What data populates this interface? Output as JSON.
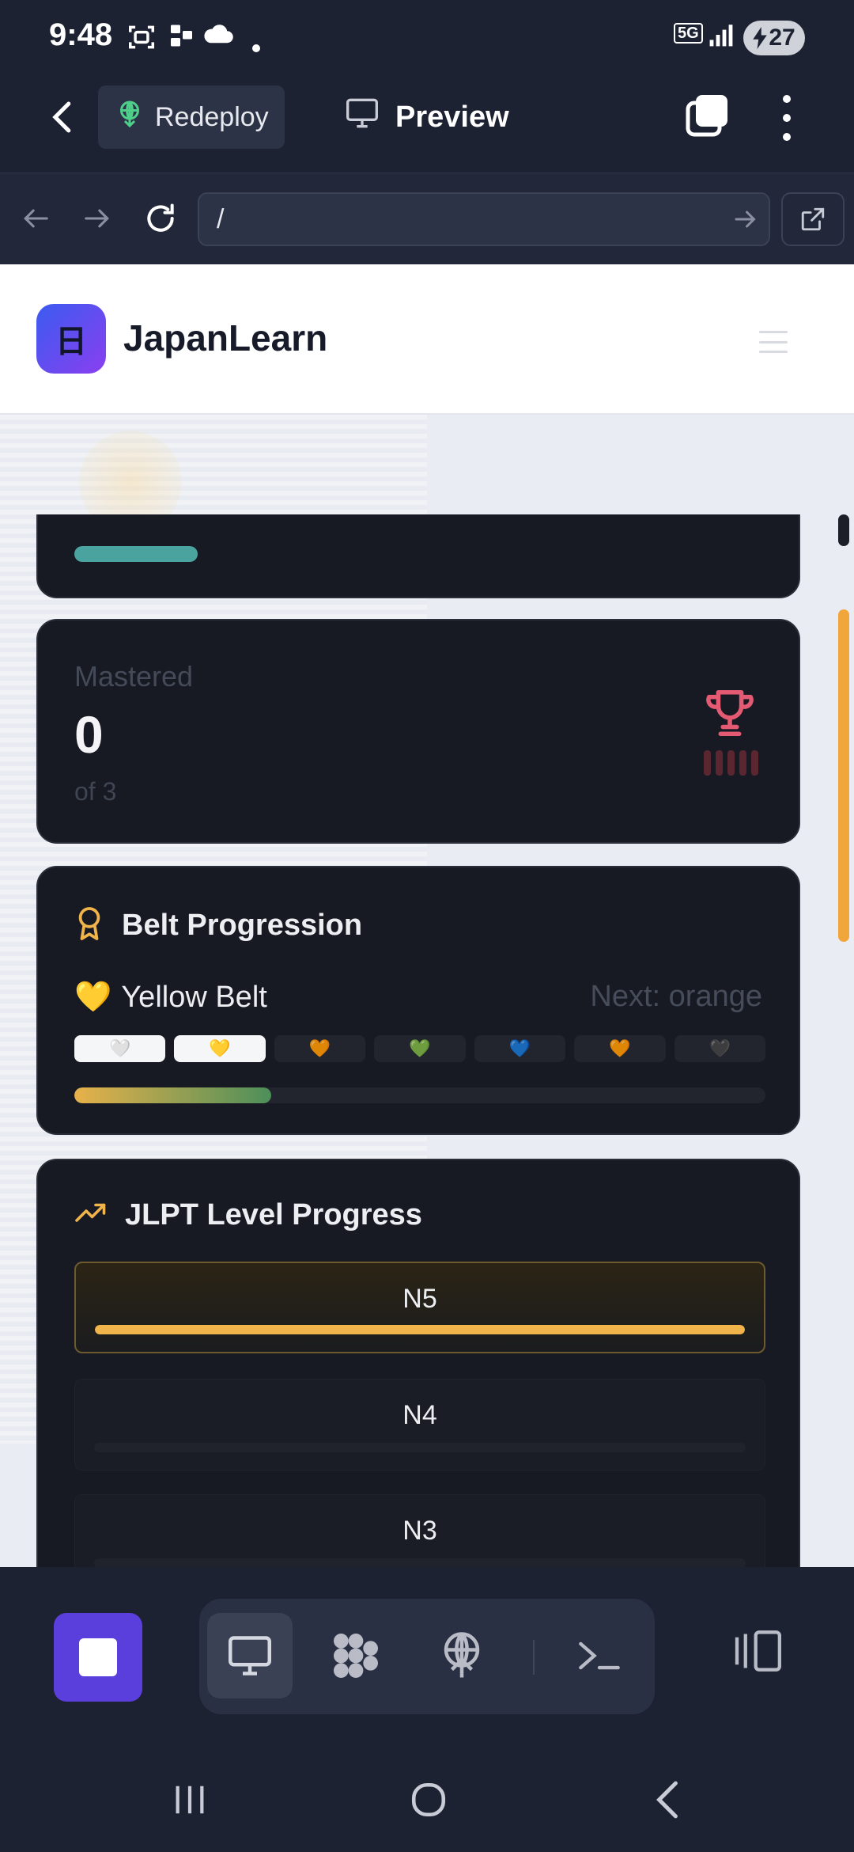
{
  "status_bar": {
    "time": "9:48",
    "network": "5G",
    "battery": "27"
  },
  "app_bar": {
    "redeploy_label": "Redeploy",
    "preview_label": "Preview"
  },
  "browser": {
    "url": "/"
  },
  "site": {
    "logo_glyph": "日",
    "name": "JapanLearn"
  },
  "stats": {
    "mastered_label": "Mastered",
    "mastered_value": "0",
    "mastered_sub": "of 3",
    "partial_progress": 0.18
  },
  "belt": {
    "title": "Belt Progression",
    "current_icon": "💛",
    "current_label": "Yellow Belt",
    "next_label": "Next: orange",
    "progress": 0.285,
    "chips": [
      {
        "icon": "🤍",
        "active": true
      },
      {
        "icon": "💛",
        "active": true
      },
      {
        "icon": "🧡",
        "active": false
      },
      {
        "icon": "💚",
        "active": false
      },
      {
        "icon": "💙",
        "active": false
      },
      {
        "icon": "🧡",
        "active": false
      },
      {
        "icon": "🖤",
        "active": false
      }
    ]
  },
  "jlpt": {
    "title": "JLPT Level Progress",
    "levels": [
      {
        "name": "N5",
        "progress": 1.0,
        "active": true
      },
      {
        "name": "N4",
        "progress": 0.0,
        "active": false
      },
      {
        "name": "N3",
        "progress": 0.0,
        "active": false
      }
    ]
  },
  "colors": {
    "accent_purple": "#5b3fdc",
    "belt_gradient_start": "#e7b14a",
    "belt_gradient_end": "#4d8f5a",
    "jlpt_fill": "#f0b44a",
    "trophy": "#e35a72",
    "teal": "#4ba3a0"
  }
}
